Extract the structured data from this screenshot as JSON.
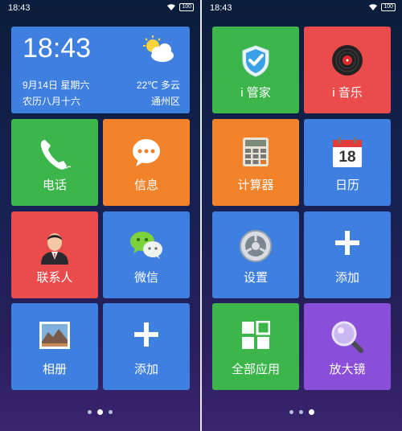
{
  "status": {
    "time": "18:43",
    "battery": "100"
  },
  "weather": {
    "time": "18:43",
    "date": "9月14日  星期六",
    "lunar": "农历八月十六",
    "temperature": "22℃ 多云",
    "location": "通州区"
  },
  "left_tiles": {
    "phone": "电话",
    "messages": "信息",
    "contacts": "联系人",
    "wechat": "微信",
    "gallery": "相册",
    "add": "添加"
  },
  "right_tiles": {
    "i_manager": "i 管家",
    "i_music": "i 音乐",
    "calculator": "计算器",
    "calendar": "日历",
    "calendar_day": "18",
    "settings": "设置",
    "add": "添加",
    "all_apps": "全部应用",
    "magnifier": "放大镜"
  },
  "colors": {
    "blue": "#3f7fe0",
    "green": "#3cb64b",
    "orange": "#f2832a",
    "red": "#ea4c4c",
    "purple": "#8a4fd8"
  },
  "pager": {
    "left_active_index": 1,
    "right_active_index": 2
  }
}
